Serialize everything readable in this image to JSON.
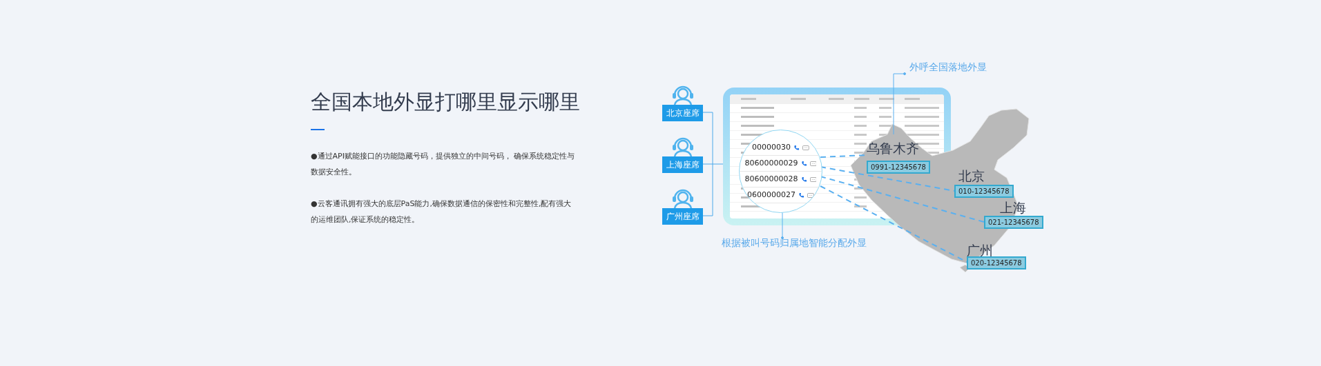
{
  "heading": "全国本地外显打哪里显示哪里",
  "bullets": [
    "●通过API赋能接口的功能隐藏号码，提供独立的中间号码， 确保系统稳定性与数据安全性。",
    "●云客通讯拥有强大的底层PaS能力,确保数据通信的保密性和完整性,配有强大的运维团队,保证系统的稳定性。"
  ],
  "illustration": {
    "agents": [
      {
        "label": "北京座席"
      },
      {
        "label": "上海座席"
      },
      {
        "label": "广州座席"
      }
    ],
    "magnifier": {
      "numbers": [
        "00000030",
        "80600000029",
        "80600000028",
        "0600000027"
      ]
    },
    "callouts": [
      {
        "text": "外呼全国落地外显"
      },
      {
        "text": "根据被叫号码归属地智能分配外显"
      }
    ],
    "cities": [
      {
        "name": "乌鲁木齐",
        "phone": "0991-12345678"
      },
      {
        "name": "北京",
        "phone": "010-12345678"
      },
      {
        "name": "上海",
        "phone": "021-12345678"
      },
      {
        "name": "广州",
        "phone": "020-12345678"
      }
    ]
  }
}
